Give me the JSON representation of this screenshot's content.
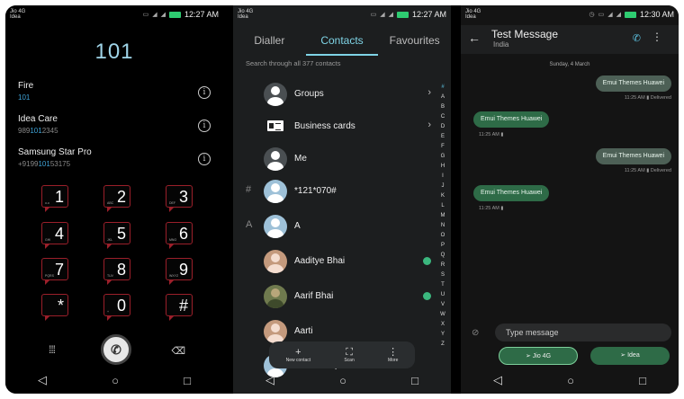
{
  "dialer": {
    "status": {
      "carrier1": "Jio 4G",
      "carrier2": "Idea",
      "time": "12:27 AM"
    },
    "number": "101",
    "suggestions": [
      {
        "name": "Fire",
        "pre": "",
        "match": "101",
        "post": ""
      },
      {
        "name": "Idea Care",
        "pre": "989",
        "match": "101",
        "post": "2345"
      },
      {
        "name": "Samsung Star Pro",
        "pre": "+9199",
        "match": "101",
        "post": "53175"
      }
    ],
    "info_icon": "i",
    "keys": [
      {
        "digit": "1",
        "letters": "o.o"
      },
      {
        "digit": "2",
        "letters": "ABC"
      },
      {
        "digit": "3",
        "letters": "DEF"
      },
      {
        "digit": "4",
        "letters": "GHI"
      },
      {
        "digit": "5",
        "letters": "JKL"
      },
      {
        "digit": "6",
        "letters": "MNO"
      },
      {
        "digit": "7",
        "letters": "PQRS"
      },
      {
        "digit": "8",
        "letters": "TUV"
      },
      {
        "digit": "9",
        "letters": "WXYZ"
      },
      {
        "digit": "*",
        "letters": ""
      },
      {
        "digit": "0",
        "letters": "+"
      },
      {
        "digit": "#",
        "letters": ""
      }
    ],
    "call_icon": "phone-icon"
  },
  "contacts": {
    "status": {
      "carrier1": "Jio 4G",
      "carrier2": "Idea",
      "time": "12:27 AM"
    },
    "tabs": [
      {
        "label": "Dialler"
      },
      {
        "label": "Contacts"
      },
      {
        "label": "Favourites"
      }
    ],
    "search_text": "Search through all 377 contacts",
    "rows": [
      {
        "name": "Groups"
      },
      {
        "name": "Business cards"
      },
      {
        "name": "Me"
      },
      {
        "name": "*121*070#",
        "header": "#"
      },
      {
        "name": "A",
        "header": "A"
      },
      {
        "name": "Aaditye Bhai"
      },
      {
        "name": "Aarif Bhai"
      },
      {
        "name": "Aarti"
      },
      {
        "name": "Aashish Vpo"
      }
    ],
    "index": [
      "#",
      "A",
      "B",
      "C",
      "D",
      "E",
      "F",
      "G",
      "H",
      "I",
      "J",
      "K",
      "L",
      "M",
      "N",
      "O",
      "P",
      "Q",
      "R",
      "S",
      "T",
      "U",
      "V",
      "W",
      "X",
      "Y",
      "Z"
    ],
    "bottom_bar": [
      {
        "label": "New contact",
        "glyph": "+"
      },
      {
        "label": "Scan",
        "glyph": "⛶"
      },
      {
        "label": "More",
        "glyph": "⋮"
      }
    ]
  },
  "message": {
    "status": {
      "carrier1": "Jio 4G",
      "carrier2": "Idea",
      "time": "12:30 AM"
    },
    "title": "Test Message",
    "subtitle": "India",
    "date": "Sunday, 4 March",
    "bubbles": [
      {
        "text": "Emui Themes Huawei",
        "meta": "11:25 AM  ▮  Delivered"
      },
      {
        "text": "Emui Themes Huawei",
        "meta": "11:25 AM  ▮"
      },
      {
        "text": "Emui Themes Huawei",
        "meta": "11:25 AM  ▮  Delivered"
      },
      {
        "text": "Emui Themes Huawei",
        "meta": "11:25 AM  ▮"
      }
    ],
    "input_placeholder": "Type message",
    "send_sim1": "Jio 4G",
    "send_sim2": "Idea"
  }
}
